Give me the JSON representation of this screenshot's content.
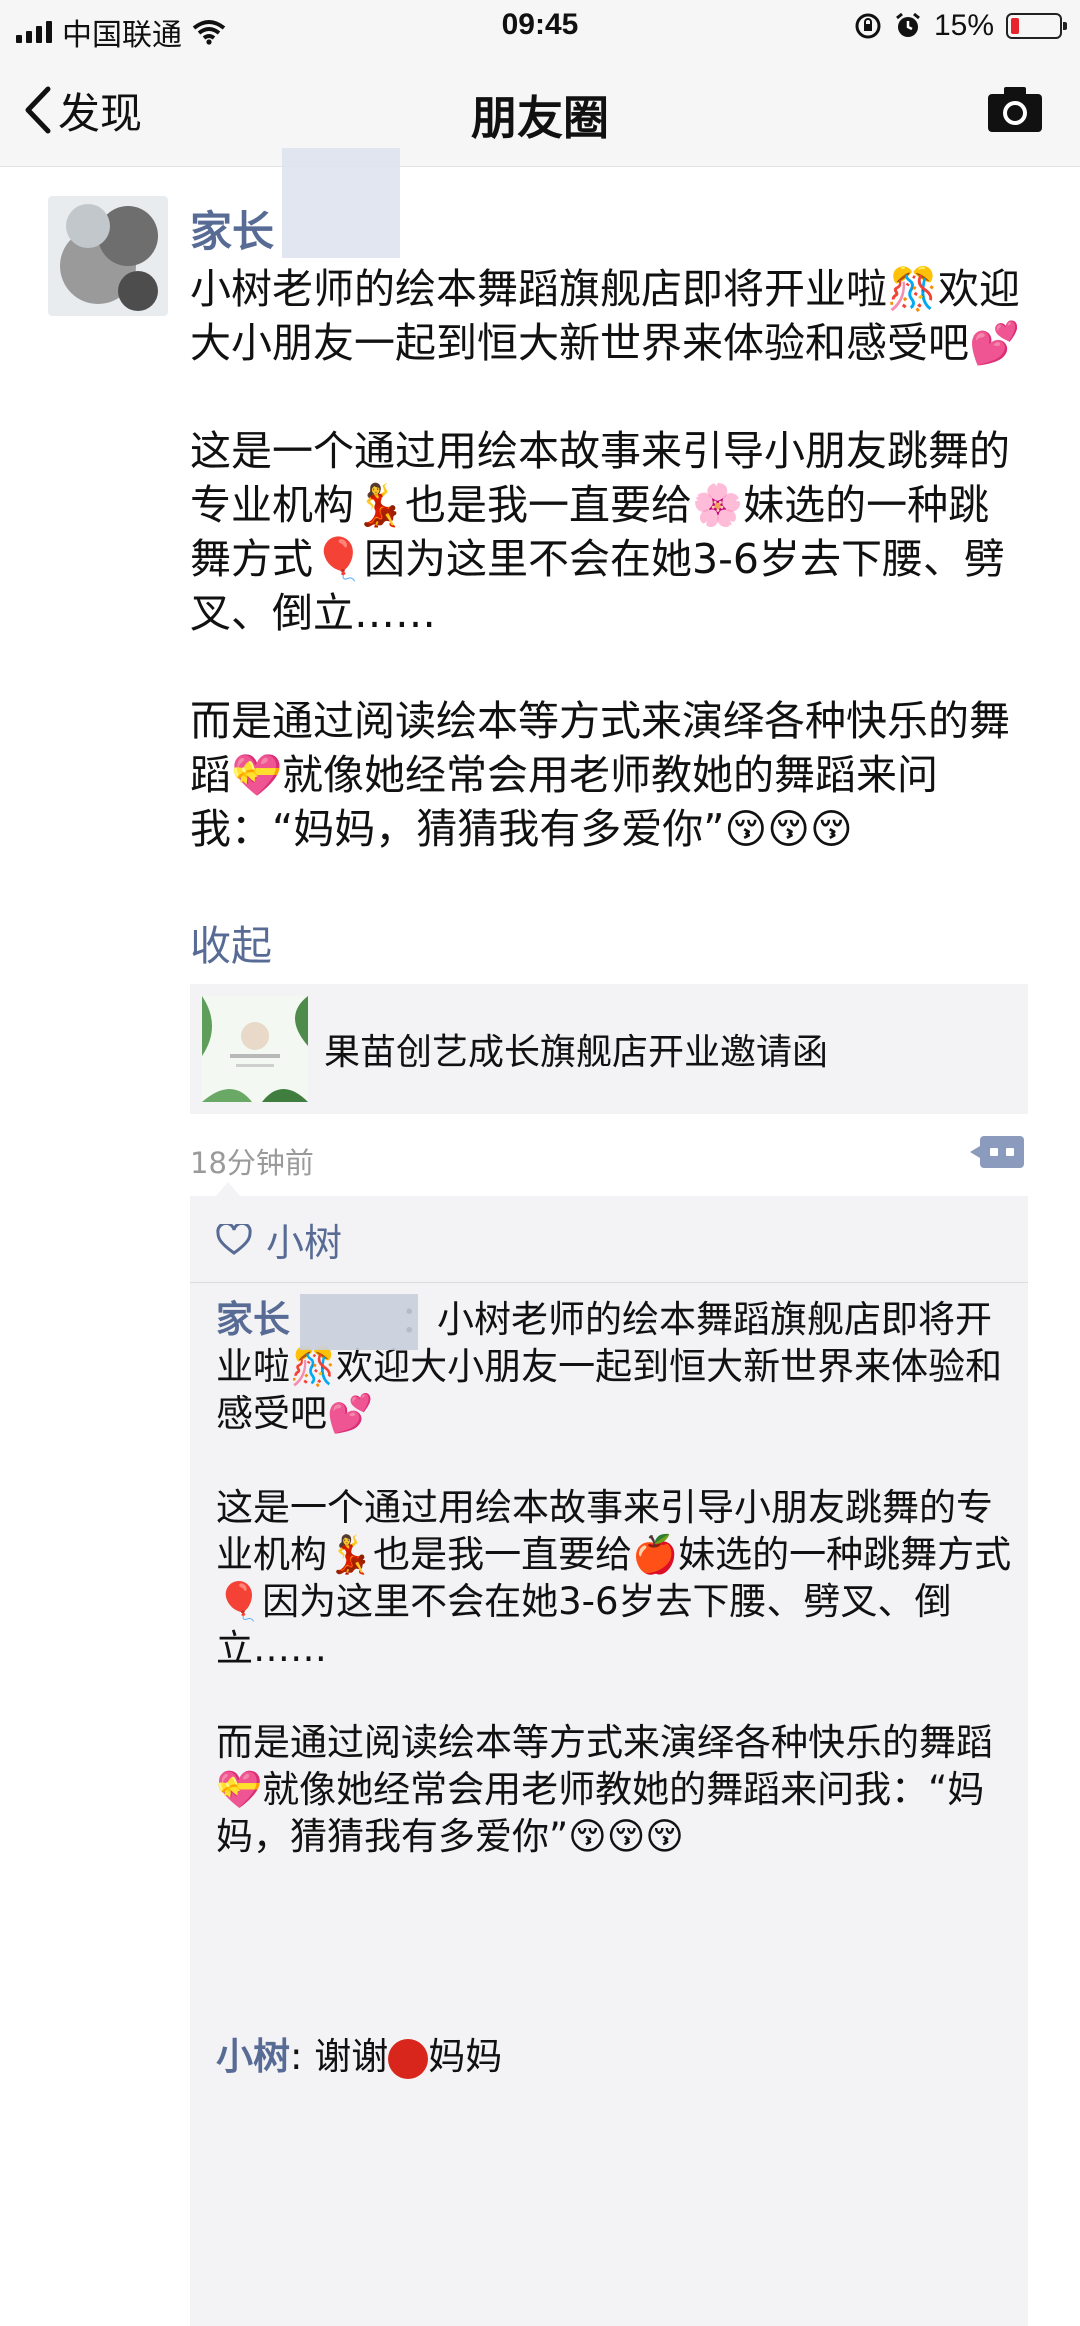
{
  "status_bar": {
    "carrier": "中国联通",
    "time": "09:45",
    "battery": "15%",
    "battery_level": 0.15,
    "battery_color": "#e8242c"
  },
  "nav": {
    "back_label": "发现",
    "title": "朋友圈"
  },
  "post": {
    "author": "家长",
    "paragraphs": [
      "小树老师的绘本舞蹈旗舰店即将开业啦🎊欢迎大小朋友一起到恒大新世界来体验和感受吧💕",
      "这是一个通过用绘本故事来引导小朋友跳舞的专业机构💃也是我一直要给🌸妹选的一种跳舞方式🎈因为这里不会在她3-6岁去下腰、劈叉、倒立……",
      "而是通过阅读绘本等方式来演绎各种快乐的舞蹈💝就像她经常会用老师教她的舞蹈来问我：“妈妈，猜猜我有多爱你”😚😚😚"
    ],
    "collapse_label": "收起",
    "link_title": "果苗创艺成长旗舰店开业邀请函",
    "time_ago": "18分钟前"
  },
  "comments": {
    "likes": "小树",
    "comment_author": "家长",
    "comment_paragraphs": [
      "：小树老师的绘本舞蹈旗舰店即将开业啦🎊欢迎大小朋友一起到恒大新世界来体验和感受吧💕",
      "这是一个通过用绘本故事来引导小朋友跳舞的专业机构💃也是我一直要给🍎妹选的一种跳舞方式🎈因为这里不会在她3-6岁去下腰、劈叉、倒立……",
      "而是通过阅读绘本等方式来演绎各种快乐的舞蹈💝就像她经常会用老师教她的舞蹈来问我：“妈妈，猜猜我有多爱你”😚😚😚"
    ],
    "reply_author": "小树",
    "reply_text_a": "谢谢",
    "reply_text_b": "妈妈"
  },
  "colors": {
    "link_blue": "#576b95",
    "bar_bg": "#f6f6f6",
    "comment_bg": "#f3f3f5"
  }
}
